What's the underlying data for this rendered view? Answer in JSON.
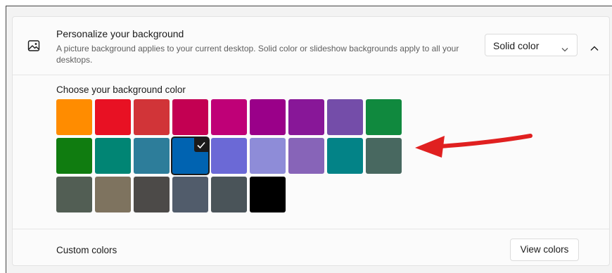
{
  "background_section": {
    "title": "Personalize your background",
    "description": "A picture background applies to your current desktop. Solid color or slideshow backgrounds apply to all your desktops.",
    "icon": "picture-icon",
    "dropdown_value": "Solid color",
    "dropdown_icon": "chevron-down-icon",
    "collapse_icon": "chevron-up-icon"
  },
  "color_picker": {
    "title": "Choose your background color",
    "selected_index": 12,
    "swatches": [
      "#FF8C00",
      "#E81123",
      "#D13438",
      "#C30052",
      "#BF0077",
      "#9A0089",
      "#881798",
      "#744DA9",
      "#10893E",
      "#107C10",
      "#018574",
      "#2D7D9A",
      "#0063B1",
      "#6B69D6",
      "#8E8CD8",
      "#8764B8",
      "#038387",
      "#486860",
      "#525E54",
      "#7E735F",
      "#4C4A48",
      "#515C6B",
      "#4A5459",
      "#000000"
    ]
  },
  "annotation": {
    "type": "red-arrow-pointing-left",
    "color": "#E02020"
  },
  "custom_colors": {
    "label": "Custom colors",
    "button_label": "View colors"
  }
}
